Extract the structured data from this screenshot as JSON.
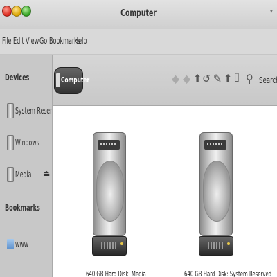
{
  "window": {
    "title": "Computer",
    "menu_glyph": "▾"
  },
  "menubar": {
    "items": [
      "File",
      "Edit",
      "View",
      "Go",
      "Bookmarks",
      "Help"
    ]
  },
  "sidebar": {
    "devices_heading": "Devices",
    "devices": [
      {
        "label": "System Reserved"
      },
      {
        "label": "Windows"
      },
      {
        "label": "Media",
        "eject": "⏏"
      }
    ],
    "bookmarks_heading": "Bookmarks",
    "bookmarks": [
      {
        "label": "www"
      }
    ]
  },
  "toolbar": {
    "location": "Computer",
    "icons": [
      "back-icon",
      "forward-icon",
      "up-icon",
      "reload-icon",
      "edit-icon",
      "new-folder-icon",
      "drive-icon",
      "search-icon"
    ],
    "search_label": "Search"
  },
  "content": {
    "items": [
      {
        "label": "640 GB Hard Disk: Media"
      },
      {
        "label": "640 GB Hard Disk: System Reserved"
      }
    ]
  }
}
